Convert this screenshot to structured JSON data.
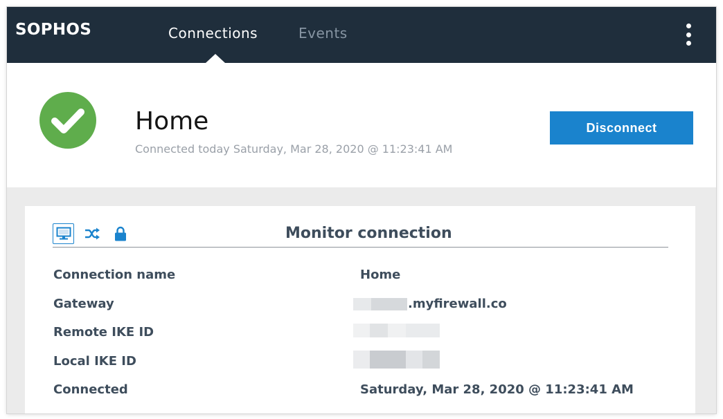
{
  "header": {
    "logo": "SOPHOS",
    "tabs": [
      {
        "label": "Connections",
        "active": true
      },
      {
        "label": "Events",
        "active": false
      }
    ],
    "menu_icon": "more-vertical-icon"
  },
  "status": {
    "icon": "check-circle-icon",
    "title": "Home",
    "subtitle": "Connected today Saturday, Mar 28, 2020 @ 11:23:41 AM",
    "button_label": "Disconnect"
  },
  "monitor": {
    "icons": [
      "monitor-icon",
      "shuffle-icon",
      "lock-icon"
    ],
    "title": "Monitor connection",
    "rows": [
      {
        "label": "Connection name",
        "value": "Home"
      },
      {
        "label": "Gateway",
        "value": ".myfirewall.co"
      },
      {
        "label": "Remote IKE ID",
        "value": ""
      },
      {
        "label": "Local IKE ID",
        "value": ""
      },
      {
        "label": "Connected",
        "value": "Saturday, Mar 28, 2020 @ 11:23:41 AM"
      }
    ]
  },
  "colors": {
    "header_bg": "#1f2e3c",
    "accent": "#1a83cd",
    "success": "#5fad4c",
    "text": "#3e4d5c",
    "muted": "#9aa0a8"
  }
}
